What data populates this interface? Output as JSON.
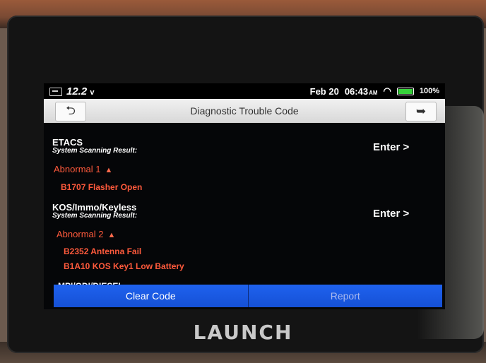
{
  "status": {
    "voltage": "12.2",
    "voltage_unit": "v",
    "date": "Feb 20",
    "time": "06:43",
    "ampm": "AM",
    "battery": "100%",
    "battery_level": 1.0
  },
  "header": {
    "title": "Diagnostic Trouble Code"
  },
  "systems": [
    {
      "name": "ETACS",
      "sub": "System Scanning Result:",
      "status": "Abnormal 1",
      "enter": "Enter >",
      "codes": [
        "B1707 Flasher Open"
      ]
    },
    {
      "name": "KOS/Immo/Keyless",
      "sub": "System Scanning Result:",
      "status": "Abnormal 2",
      "enter": "Enter >",
      "codes": [
        "B2352 Antenna Fail",
        "B1A10 KOS Key1 Low Battery"
      ]
    },
    {
      "name": "MPI/GDI/DIESEL"
    }
  ],
  "footer": {
    "clear_label": "Clear Code",
    "report_label": "Report"
  },
  "device": {
    "brand": "LAUNCH"
  },
  "colors": {
    "accent": "#1a58e6",
    "error": "#ff5a3c",
    "battery": "#36d23a"
  },
  "icons": {
    "back": "back-arrow-icon",
    "exit": "exit-icon",
    "wifi": "wifi-icon",
    "battery": "battery-icon",
    "car_battery": "car-battery-icon"
  }
}
